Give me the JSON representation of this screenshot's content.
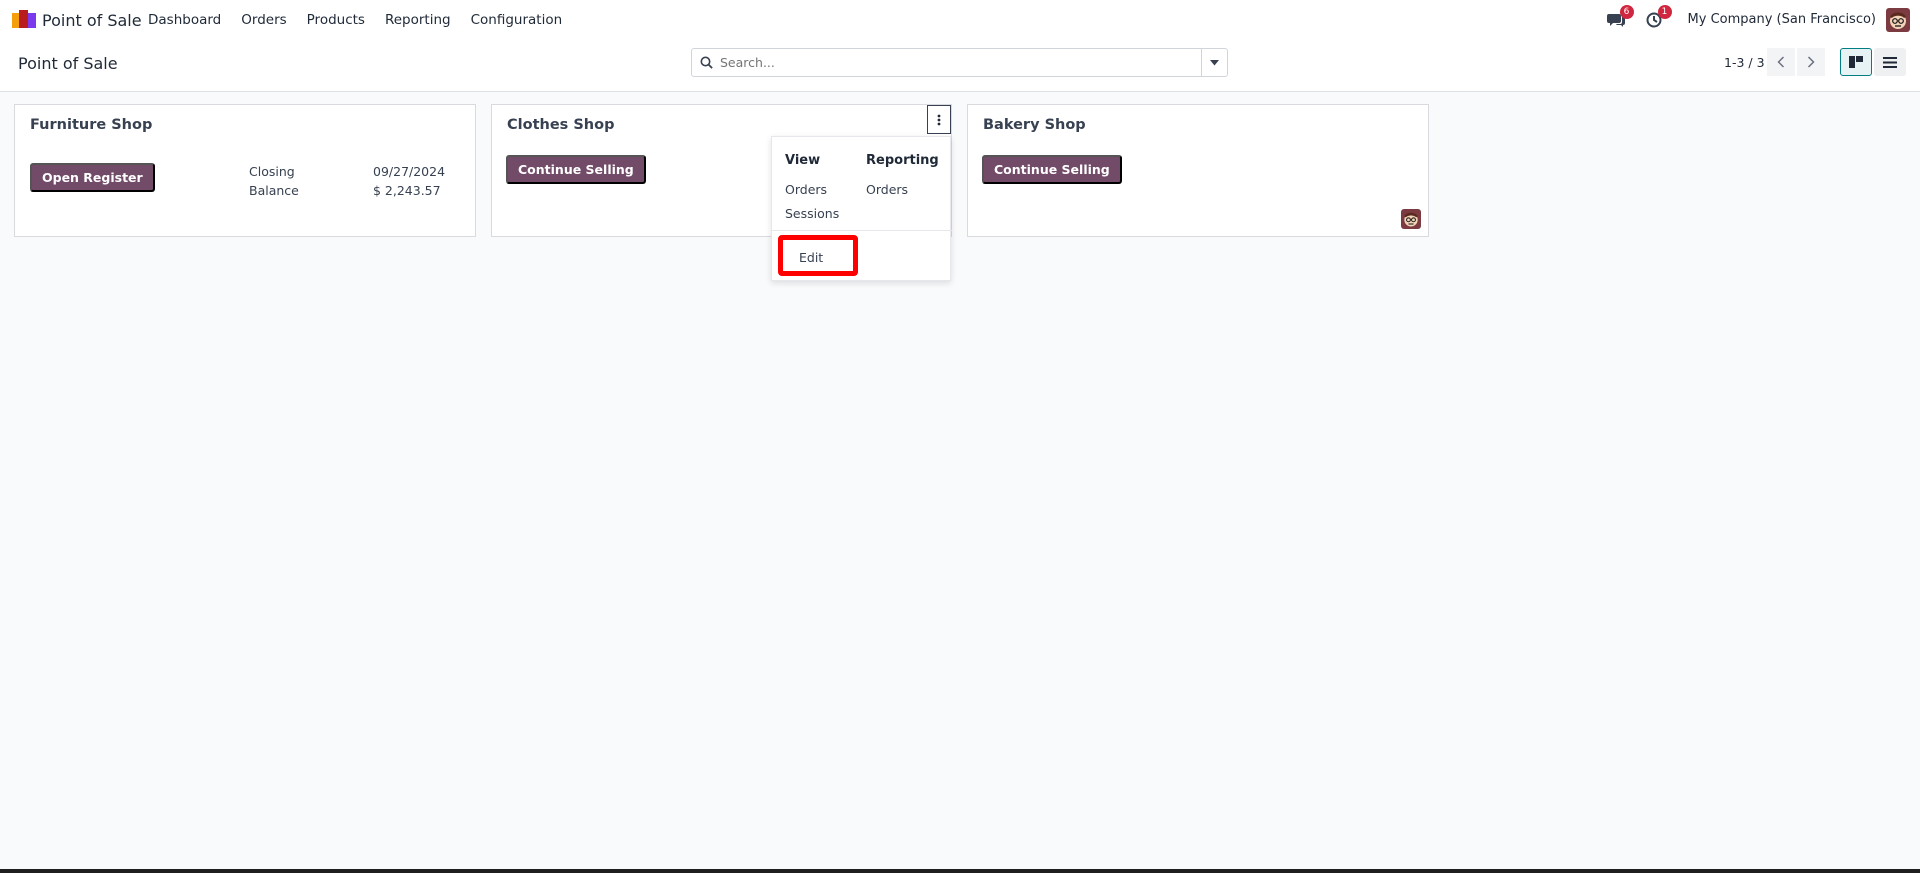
{
  "navbar": {
    "app_name": "Point of Sale",
    "menu": [
      "Dashboard",
      "Orders",
      "Products",
      "Reporting",
      "Configuration"
    ],
    "messages_badge": "6",
    "activities_badge": "1",
    "company": "My Company (San Francisco)"
  },
  "control_panel": {
    "breadcrumb": "Point of Sale",
    "search_placeholder": "Search...",
    "pager": "1-3 / 3"
  },
  "cards": [
    {
      "title": "Furniture Shop",
      "button": "Open Register",
      "closing_label": "Closing",
      "closing_value": "09/27/2024",
      "balance_label": "Balance",
      "balance_value": "$ 2,243.57"
    },
    {
      "title": "Clothes Shop",
      "button": "Continue Selling"
    },
    {
      "title": "Bakery Shop",
      "button": "Continue Selling"
    }
  ],
  "dropdown": {
    "view_header": "View",
    "reporting_header": "Reporting",
    "view_items": [
      "Orders",
      "Sessions"
    ],
    "reporting_items": [
      "Orders"
    ],
    "edit": "Edit"
  },
  "colors": {
    "primary": "#714b67",
    "badge": "#d0263f",
    "highlight": "#ff0000",
    "active_view": "#017e84"
  }
}
